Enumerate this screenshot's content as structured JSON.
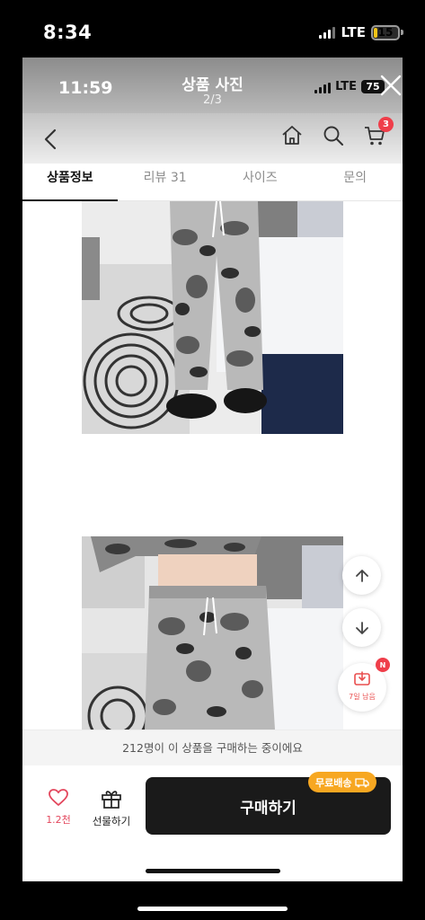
{
  "outer_status": {
    "time": "8:34",
    "network": "LTE",
    "battery": "15",
    "battery_level": 0.15
  },
  "viewer": {
    "inner_time": "11:59",
    "title": "상품 사진",
    "counter": "2/3",
    "network": "LTE",
    "battery": "75",
    "close_icon": "close-icon"
  },
  "nav": {
    "back_icon": "chevron-left-icon",
    "icons": [
      "home-icon",
      "search-icon",
      "cart-icon"
    ],
    "cart_count": "3"
  },
  "tabs": [
    {
      "label": "상품정보",
      "active": true
    },
    {
      "label": "리뷰 31",
      "active": false
    },
    {
      "label": "사이즈",
      "active": false
    },
    {
      "label": "문의",
      "active": false
    }
  ],
  "floating": {
    "up_icon": "arrow-up-icon",
    "down_icon": "arrow-down-icon",
    "coupon_label": "7일 남음",
    "coupon_badge": "N"
  },
  "notice": "212명이 이 상품을 구매하는 중이에요",
  "bottom": {
    "like_count": "1.2천",
    "gift_label": "선물하기",
    "buy_label": "구매하기",
    "shipping_badge": "무료배송",
    "accent": "#f7a721",
    "like_color": "#e3475d"
  }
}
